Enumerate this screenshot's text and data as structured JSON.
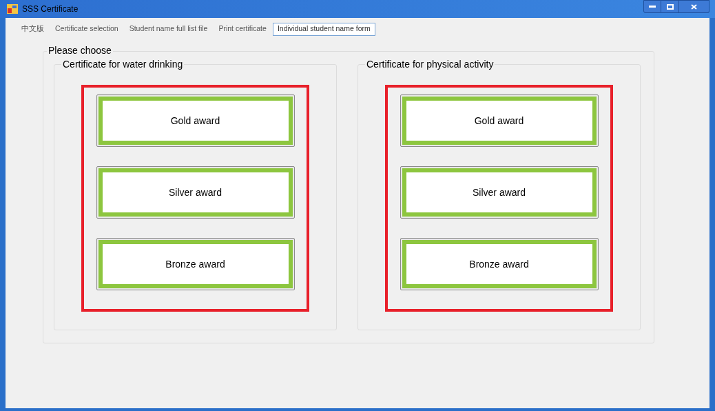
{
  "window": {
    "title": "SSS Certificate"
  },
  "menu": [
    {
      "label": "中文版",
      "selected": false
    },
    {
      "label": "Certificate selection",
      "selected": false
    },
    {
      "label": "Student name full list file",
      "selected": false
    },
    {
      "label": "Print certificate",
      "selected": false
    },
    {
      "label": "Individual student name form",
      "selected": true
    }
  ],
  "group": {
    "title": "Please choose",
    "sections": [
      {
        "title": "Certificate for water drinking",
        "buttons": [
          "Gold award",
          "Silver award",
          "Bronze award"
        ]
      },
      {
        "title": "Certificate for physical activity",
        "buttons": [
          "Gold award",
          "Silver award",
          "Bronze award"
        ]
      }
    ]
  }
}
